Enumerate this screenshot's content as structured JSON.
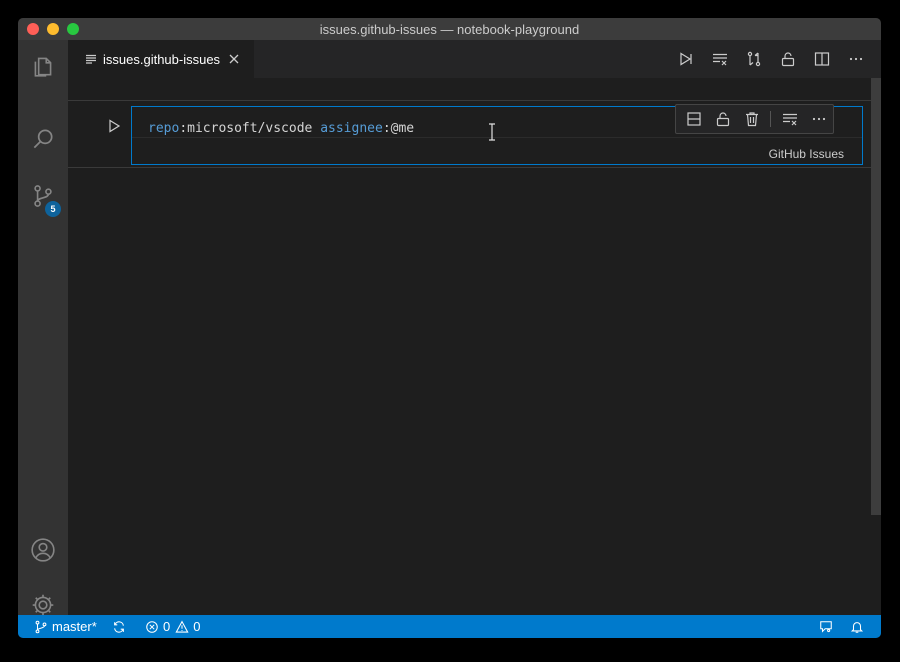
{
  "window": {
    "title": "issues.github-issues — notebook-playground"
  },
  "activity_bar": {
    "items": [
      {
        "name": "explorer",
        "icon": "files-icon"
      },
      {
        "name": "search",
        "icon": "search-icon"
      },
      {
        "name": "source-control",
        "icon": "source-control-icon",
        "badge": "5"
      },
      {
        "name": "accounts",
        "icon": "account-icon"
      },
      {
        "name": "manage",
        "icon": "gear-icon"
      }
    ]
  },
  "tabs": [
    {
      "label": "issues.github-issues",
      "active": true
    }
  ],
  "editor_actions": [
    "run-all-icon",
    "clear-outputs-icon",
    "compare-icon",
    "unlock-icon",
    "split-editor-icon",
    "more-icon"
  ],
  "cell": {
    "code_tokens": [
      {
        "text": "repo",
        "kind": "keyword"
      },
      {
        "text": ":microsoft/vscode ",
        "kind": "text"
      },
      {
        "text": "assignee",
        "kind": "keyword"
      },
      {
        "text": ":@me",
        "kind": "text"
      }
    ],
    "language": "GitHub Issues",
    "toolbar": [
      "split-cell-icon",
      "unlock-icon",
      "trash-icon",
      "clear-output-icon",
      "more-icon"
    ]
  },
  "status_bar": {
    "branch": "master*",
    "errors": "0",
    "warnings": "0"
  },
  "colors": {
    "accent": "#007acc",
    "keyword": "#569cd6",
    "badge": "#0e639c"
  }
}
